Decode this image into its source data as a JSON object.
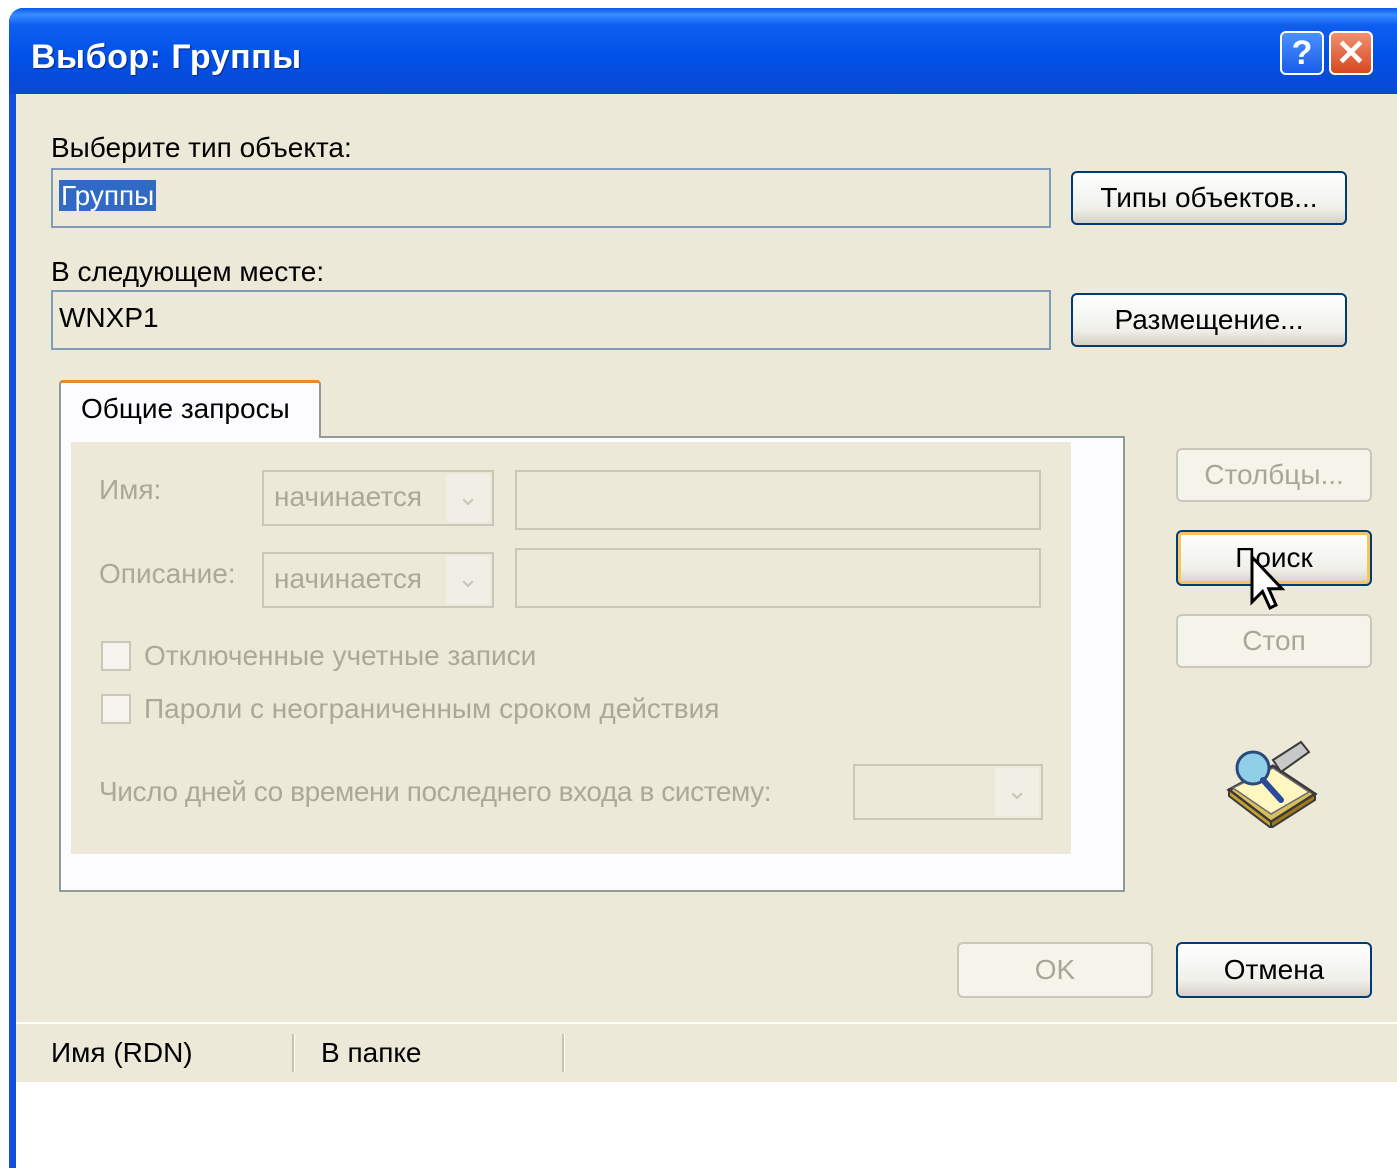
{
  "window": {
    "title": "Выбор: Группы",
    "help_icon": "?",
    "close_icon": "✕"
  },
  "object_type": {
    "label": "Выберите тип объекта:",
    "value": "Группы",
    "button": "Типы объектов..."
  },
  "location": {
    "label": "В следующем месте:",
    "value": "WNXP1",
    "button": "Размещение..."
  },
  "tab": {
    "label": "Общие запросы"
  },
  "query": {
    "name_label": "Имя:",
    "name_op": "начинается",
    "description_label": "Описание:",
    "description_op": "начинается",
    "disabled_accounts_label": "Отключенные учетные записи",
    "nonexpiring_passwords_label": "Пароли с неограниченным сроком действия",
    "days_since_logon_label": "Число дней со времени последнего входа в систему:"
  },
  "side_buttons": {
    "columns": "Столбцы...",
    "search": "Поиск",
    "stop": "Стоп"
  },
  "footer_buttons": {
    "ok": "OK",
    "cancel": "Отмена"
  },
  "results": {
    "columns": [
      "Имя (RDN)",
      "В папке"
    ]
  },
  "colors": {
    "title_bar": "#0050e6",
    "dialog_bg": "#ece9d8",
    "selection": "#316ac5",
    "tab_accent": "#e68b2c"
  }
}
